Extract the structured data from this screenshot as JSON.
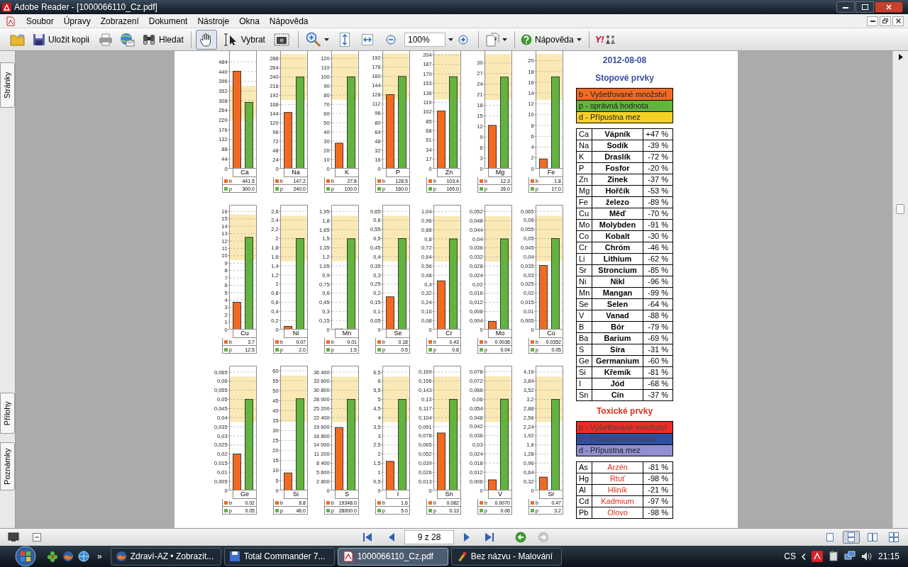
{
  "window": {
    "title": "Adobe Reader - [1000066110_Cz.pdf]"
  },
  "menu": [
    "Soubor",
    "Úpravy",
    "Zobrazení",
    "Dokument",
    "Nástroje",
    "Okna",
    "Nápověda"
  ],
  "toolbar": {
    "save": "Uložit kopii",
    "search": "Hledat",
    "tools": [
      {
        "kind": "hand",
        "selected": true
      },
      {
        "kind": "select",
        "label": "Vybrat",
        "selected": false
      }
    ],
    "zoom": "100%",
    "help": "Nápověda",
    "logo": "Y!"
  },
  "side_tabs": [
    "Stránky",
    "Přílohy",
    "Poznámky"
  ],
  "charts": [
    {
      "readings": [
        "441.5",
        "300.0"
      ],
      "chart_data": {
        "type": "bar",
        "grid": true,
        "legend": true,
        "bands": [
          {
            "axis": "y",
            "from": 225,
            "to": 375
          }
        ],
        "categories": [
          "Ca"
        ],
        "series": [
          {
            "name": "b",
            "color": "#f26a21",
            "values": [
              441.5
            ]
          },
          {
            "name": "p",
            "color": "#63b33f",
            "values": [
              300
            ]
          }
        ],
        "ylim": [
          0,
          533
        ],
        "yticks": [
          0,
          44,
          88,
          132,
          176,
          220,
          264,
          308,
          352,
          396,
          440,
          484
        ]
      }
    },
    {
      "readings": [
        "147.2",
        "240.0"
      ],
      "chart_data": {
        "type": "bar",
        "grid": true,
        "legend": true,
        "bands": [
          {
            "axis": "y",
            "from": 180,
            "to": 300
          }
        ],
        "categories": [
          "Na"
        ],
        "series": [
          {
            "name": "b",
            "color": "#f26a21",
            "values": [
              147.2
            ]
          },
          {
            "name": "p",
            "color": "#63b33f",
            "values": [
              240
            ]
          }
        ],
        "ylim": [
          0,
          308
        ],
        "yticks": [
          0,
          24,
          48,
          72,
          96,
          120,
          144,
          168,
          192,
          216,
          240,
          264,
          288
        ]
      }
    },
    {
      "readings": [
        "27.8",
        "100.0"
      ],
      "chart_data": {
        "type": "bar",
        "grid": true,
        "legend": true,
        "bands": [
          {
            "axis": "y",
            "from": 75,
            "to": 125
          }
        ],
        "categories": [
          "K"
        ],
        "series": [
          {
            "name": "b",
            "color": "#f26a21",
            "values": [
              27.8
            ]
          },
          {
            "name": "p",
            "color": "#63b33f",
            "values": [
              100
            ]
          }
        ],
        "ylim": [
          0,
          128
        ],
        "yticks": [
          0,
          10,
          20,
          30,
          40,
          50,
          60,
          70,
          80,
          90,
          100,
          110,
          120
        ]
      }
    },
    {
      "readings": [
        "128.5",
        "160.0"
      ],
      "chart_data": {
        "type": "bar",
        "grid": true,
        "legend": true,
        "bands": [
          {
            "axis": "y",
            "from": 120,
            "to": 200
          }
        ],
        "categories": [
          "P"
        ],
        "series": [
          {
            "name": "b",
            "color": "#f26a21",
            "values": [
              128.5
            ]
          },
          {
            "name": "p",
            "color": "#63b33f",
            "values": [
              160
            ]
          }
        ],
        "ylim": [
          0,
          204
        ],
        "yticks": [
          0,
          16,
          32,
          48,
          64,
          80,
          96,
          112,
          128,
          144,
          160,
          176,
          192
        ]
      }
    },
    {
      "readings": [
        "103.4",
        "165.0"
      ],
      "chart_data": {
        "type": "bar",
        "grid": true,
        "legend": true,
        "bands": [
          {
            "axis": "y",
            "from": 124,
            "to": 206
          }
        ],
        "categories": [
          "Zn"
        ],
        "series": [
          {
            "name": "b",
            "color": "#f26a21",
            "values": [
              103.4
            ]
          },
          {
            "name": "p",
            "color": "#63b33f",
            "values": [
              165
            ]
          }
        ],
        "ylim": [
          0,
          211
        ],
        "yticks": [
          0,
          17,
          34,
          51,
          68,
          85,
          102,
          119,
          136,
          153,
          170,
          187,
          204
        ]
      }
    },
    {
      "readings": [
        "12.3",
        "26.0"
      ],
      "chart_data": {
        "type": "bar",
        "grid": true,
        "legend": true,
        "bands": [
          {
            "axis": "y",
            "from": 19.5,
            "to": 32.5
          }
        ],
        "categories": [
          "Mg"
        ],
        "series": [
          {
            "name": "b",
            "color": "#f26a21",
            "values": [
              12.3
            ]
          },
          {
            "name": "p",
            "color": "#63b33f",
            "values": [
              26
            ]
          }
        ],
        "ylim": [
          0,
          33.4
        ],
        "yticks": [
          0,
          3,
          6,
          9,
          12,
          15,
          18,
          21,
          24,
          27,
          30
        ]
      }
    },
    {
      "readings": [
        "1.8",
        "17.0"
      ],
      "chart_data": {
        "type": "bar",
        "grid": true,
        "legend": true,
        "bands": [
          {
            "axis": "y",
            "from": 12.75,
            "to": 21.25
          }
        ],
        "categories": [
          "Fe"
        ],
        "series": [
          {
            "name": "b",
            "color": "#f26a21",
            "values": [
              1.8
            ]
          },
          {
            "name": "p",
            "color": "#63b33f",
            "values": [
              17
            ]
          }
        ],
        "ylim": [
          0,
          21.8
        ],
        "yticks": [
          0,
          2,
          4,
          6,
          8,
          10,
          12,
          14,
          16,
          18,
          20
        ]
      }
    },
    {
      "readings": [
        "3.7",
        "12.5"
      ],
      "chart_data": {
        "type": "bar",
        "grid": true,
        "legend": true,
        "bands": [
          {
            "axis": "y",
            "from": 9.4,
            "to": 15.6
          }
        ],
        "categories": [
          "Cu"
        ],
        "series": [
          {
            "name": "b",
            "color": "#f26a21",
            "values": [
              3.7
            ]
          },
          {
            "name": "p",
            "color": "#63b33f",
            "values": [
              12.5
            ]
          }
        ],
        "ylim": [
          0,
          16.9
        ],
        "yticks": [
          0,
          1,
          2,
          3,
          4,
          5,
          6,
          7,
          8,
          9,
          10,
          11,
          12,
          13,
          14,
          15,
          16
        ]
      }
    },
    {
      "readings": [
        "0.07",
        "2.0"
      ],
      "chart_data": {
        "type": "bar",
        "grid": true,
        "legend": true,
        "bands": [
          {
            "axis": "y",
            "from": 1.5,
            "to": 2.5
          }
        ],
        "categories": [
          "Ni"
        ],
        "series": [
          {
            "name": "b",
            "color": "#f26a21",
            "values": [
              0.07
            ]
          },
          {
            "name": "p",
            "color": "#63b33f",
            "values": [
              2
            ]
          }
        ],
        "ylim": [
          0,
          2.74
        ],
        "yticks": [
          0,
          {
            "value": 0.2,
            "label": "0,2"
          },
          {
            "value": 0.4,
            "label": "0,4"
          },
          {
            "value": 0.6,
            "label": "0,6"
          },
          {
            "value": 0.8,
            "label": "0,8"
          },
          1,
          {
            "value": 1.2,
            "label": "1,2"
          },
          {
            "value": 1.4,
            "label": "1,4"
          },
          {
            "value": 1.6,
            "label": "1,6"
          },
          {
            "value": 1.8,
            "label": "1,8"
          },
          2,
          {
            "value": 2.2,
            "label": "2,2"
          },
          {
            "value": 2.4,
            "label": "2,4"
          },
          {
            "value": 2.6,
            "label": "2,6"
          }
        ]
      }
    },
    {
      "readings": [
        "0.01",
        "1.5"
      ],
      "chart_data": {
        "type": "bar",
        "grid": true,
        "legend": true,
        "bands": [
          {
            "axis": "y",
            "from": 1.13,
            "to": 1.88
          }
        ],
        "categories": [
          "Mn"
        ],
        "series": [
          {
            "name": "b",
            "color": "#f26a21",
            "values": [
              0.01
            ]
          },
          {
            "name": "p",
            "color": "#63b33f",
            "values": [
              1.5
            ]
          }
        ],
        "ylim": [
          0,
          2.06
        ],
        "yticks": [
          0,
          {
            "value": 0.15,
            "label": "0,15"
          },
          {
            "value": 0.3,
            "label": "0,3"
          },
          {
            "value": 0.45,
            "label": "0,45"
          },
          {
            "value": 0.6,
            "label": "0,6"
          },
          {
            "value": 0.75,
            "label": "0,75"
          },
          {
            "value": 0.9,
            "label": "0,9"
          },
          {
            "value": 1.05,
            "label": "1,05"
          },
          {
            "value": 1.2,
            "label": "1,2"
          },
          {
            "value": 1.35,
            "label": "1,35"
          },
          {
            "value": 1.5,
            "label": "1,5"
          },
          {
            "value": 1.65,
            "label": "1,65"
          },
          {
            "value": 1.8,
            "label": "1,8"
          },
          {
            "value": 1.95,
            "label": "1,95"
          }
        ]
      }
    },
    {
      "readings": [
        "0.18",
        "0.5"
      ],
      "chart_data": {
        "type": "bar",
        "grid": true,
        "legend": true,
        "bands": [
          {
            "axis": "y",
            "from": 0.375,
            "to": 0.625
          }
        ],
        "categories": [
          "Se"
        ],
        "series": [
          {
            "name": "b",
            "color": "#f26a21",
            "values": [
              0.18
            ]
          },
          {
            "name": "p",
            "color": "#63b33f",
            "values": [
              0.5
            ]
          }
        ],
        "ylim": [
          0,
          0.685
        ],
        "yticks": [
          0,
          {
            "value": 0.05,
            "label": "0,05"
          },
          {
            "value": 0.1,
            "label": "0,1"
          },
          {
            "value": 0.15,
            "label": "0,15"
          },
          {
            "value": 0.2,
            "label": "0,2"
          },
          {
            "value": 0.25,
            "label": "0,25"
          },
          {
            "value": 0.3,
            "label": "0,3"
          },
          {
            "value": 0.35,
            "label": "0,35"
          },
          {
            "value": 0.4,
            "label": "0,4"
          },
          {
            "value": 0.45,
            "label": "0,45"
          },
          {
            "value": 0.5,
            "label": "0,5"
          },
          {
            "value": 0.55,
            "label": "0,55"
          },
          {
            "value": 0.6,
            "label": "0,6"
          },
          {
            "value": 0.65,
            "label": "0,65"
          }
        ]
      }
    },
    {
      "readings": [
        "0.43",
        "0.8"
      ],
      "chart_data": {
        "type": "bar",
        "grid": true,
        "legend": true,
        "bands": [
          {
            "axis": "y",
            "from": 0.6,
            "to": 1
          }
        ],
        "categories": [
          "Cr"
        ],
        "series": [
          {
            "name": "b",
            "color": "#f26a21",
            "values": [
              0.43
            ]
          },
          {
            "name": "p",
            "color": "#63b33f",
            "values": [
              0.8
            ]
          }
        ],
        "ylim": [
          0,
          1.1
        ],
        "yticks": [
          0,
          {
            "value": 0.08,
            "label": "0,08"
          },
          {
            "value": 0.16,
            "label": "0,16"
          },
          {
            "value": 0.24,
            "label": "0,24"
          },
          {
            "value": 0.32,
            "label": "0,32"
          },
          {
            "value": 0.4,
            "label": "0,4"
          },
          {
            "value": 0.48,
            "label": "0,48"
          },
          {
            "value": 0.56,
            "label": "0,56"
          },
          {
            "value": 0.64,
            "label": "0,64"
          },
          {
            "value": 0.72,
            "label": "0,72"
          },
          {
            "value": 0.8,
            "label": "0,8"
          },
          {
            "value": 0.88,
            "label": "0,88"
          },
          {
            "value": 0.96,
            "label": "0,96"
          },
          {
            "value": 1.04,
            "label": "1,04"
          }
        ]
      }
    },
    {
      "readings": [
        "0.0036",
        "0.04"
      ],
      "chart_data": {
        "type": "bar",
        "grid": true,
        "legend": true,
        "bands": [
          {
            "axis": "y",
            "from": 0.03,
            "to": 0.05
          }
        ],
        "categories": [
          "Mo"
        ],
        "series": [
          {
            "name": "b",
            "color": "#f26a21",
            "values": [
              0.0036
            ]
          },
          {
            "name": "p",
            "color": "#63b33f",
            "values": [
              0.04
            ]
          }
        ],
        "ylim": [
          0,
          0.055
        ],
        "yticks": [
          0,
          {
            "value": 0.004,
            "label": "0,004"
          },
          {
            "value": 0.008,
            "label": "0,008"
          },
          {
            "value": 0.012,
            "label": "0,012"
          },
          {
            "value": 0.016,
            "label": "0,016"
          },
          {
            "value": 0.02,
            "label": "0,02"
          },
          {
            "value": 0.024,
            "label": "0,024"
          },
          {
            "value": 0.028,
            "label": "0,028"
          },
          {
            "value": 0.032,
            "label": "0,032"
          },
          {
            "value": 0.036,
            "label": "0,036"
          },
          {
            "value": 0.04,
            "label": "0,04"
          },
          {
            "value": 0.044,
            "label": "0,044"
          },
          {
            "value": 0.048,
            "label": "0,048"
          },
          {
            "value": 0.052,
            "label": "0,052"
          }
        ]
      }
    },
    {
      "readings": [
        "0.0352",
        "0.05"
      ],
      "chart_data": {
        "type": "bar",
        "grid": true,
        "legend": true,
        "bands": [
          {
            "axis": "y",
            "from": 0.0375,
            "to": 0.0625
          }
        ],
        "categories": [
          "Co"
        ],
        "series": [
          {
            "name": "b",
            "color": "#f26a21",
            "values": [
              0.0352
            ]
          },
          {
            "name": "p",
            "color": "#63b33f",
            "values": [
              0.05
            ]
          }
        ],
        "ylim": [
          0,
          0.0685
        ],
        "yticks": [
          0,
          {
            "value": 0.005,
            "label": "0,005"
          },
          {
            "value": 0.01,
            "label": "0,01"
          },
          {
            "value": 0.015,
            "label": "0,015"
          },
          {
            "value": 0.02,
            "label": "0,02"
          },
          {
            "value": 0.025,
            "label": "0,025"
          },
          {
            "value": 0.03,
            "label": "0,03"
          },
          {
            "value": 0.035,
            "label": "0,035"
          },
          {
            "value": 0.04,
            "label": "0,04"
          },
          {
            "value": 0.045,
            "label": "0,045"
          },
          {
            "value": 0.05,
            "label": "0,05"
          },
          {
            "value": 0.055,
            "label": "0,055"
          },
          {
            "value": 0.06,
            "label": "0,06"
          },
          {
            "value": 0.065,
            "label": "0,065"
          }
        ]
      }
    },
    {
      "readings": [
        "0.02",
        "0.05"
      ],
      "chart_data": {
        "type": "bar",
        "grid": true,
        "legend": true,
        "bands": [
          {
            "axis": "y",
            "from": 0.0375,
            "to": 0.0625
          }
        ],
        "categories": [
          "Ge"
        ],
        "series": [
          {
            "name": "b",
            "color": "#f26a21",
            "values": [
              0.02
            ]
          },
          {
            "name": "p",
            "color": "#63b33f",
            "values": [
              0.05
            ]
          }
        ],
        "ylim": [
          0,
          0.0685
        ],
        "yticks": [
          0,
          {
            "value": 0.005,
            "label": "0,005"
          },
          {
            "value": 0.01,
            "label": "0,01"
          },
          {
            "value": 0.015,
            "label": "0,015"
          },
          {
            "value": 0.02,
            "label": "0,02"
          },
          {
            "value": 0.025,
            "label": "0,025"
          },
          {
            "value": 0.03,
            "label": "0,03"
          },
          {
            "value": 0.035,
            "label": "0,035"
          },
          {
            "value": 0.04,
            "label": "0,04"
          },
          {
            "value": 0.045,
            "label": "0,045"
          },
          {
            "value": 0.05,
            "label": "0,05"
          },
          {
            "value": 0.055,
            "label": "0,055"
          },
          {
            "value": 0.06,
            "label": "0,06"
          },
          {
            "value": 0.065,
            "label": "0,065"
          }
        ]
      }
    },
    {
      "readings": [
        "8.8",
        "46.0"
      ],
      "chart_data": {
        "type": "bar",
        "grid": true,
        "legend": true,
        "bands": [
          {
            "axis": "y",
            "from": 34.5,
            "to": 57.5
          }
        ],
        "categories": [
          "Si"
        ],
        "series": [
          {
            "name": "b",
            "color": "#f26a21",
            "values": [
              8.8
            ]
          },
          {
            "name": "p",
            "color": "#63b33f",
            "values": [
              46
            ]
          }
        ],
        "ylim": [
          0,
          62.5
        ],
        "yticks": [
          0,
          5,
          10,
          15,
          20,
          25,
          30,
          35,
          40,
          45,
          50,
          55,
          60
        ]
      }
    },
    {
      "readings": [
        "19348.0",
        "28000.0"
      ],
      "chart_data": {
        "type": "bar",
        "grid": true,
        "legend": true,
        "bands": [
          {
            "axis": "y",
            "from": 21000,
            "to": 35000
          }
        ],
        "categories": [
          "S"
        ],
        "series": [
          {
            "name": "b",
            "color": "#f26a21",
            "values": [
              19348
            ]
          },
          {
            "name": "p",
            "color": "#63b33f",
            "values": [
              28000
            ]
          }
        ],
        "ylim": [
          0,
          38360
        ],
        "yticks": [
          0,
          {
            "value": 2800,
            "label": "2 800"
          },
          {
            "value": 5600,
            "label": "5 600"
          },
          {
            "value": 8400,
            "label": "8 400"
          },
          {
            "value": 11200,
            "label": "11 200"
          },
          {
            "value": 14000,
            "label": "14 000"
          },
          {
            "value": 16800,
            "label": "16 800"
          },
          {
            "value": 19600,
            "label": "19 600"
          },
          {
            "value": 22400,
            "label": "22 400"
          },
          {
            "value": 25200,
            "label": "25 200"
          },
          {
            "value": 28000,
            "label": "28 000"
          },
          {
            "value": 30800,
            "label": "30 800"
          },
          {
            "value": 33600,
            "label": "33 600"
          },
          {
            "value": 36400,
            "label": "36 400"
          }
        ]
      }
    },
    {
      "readings": [
        "1.6",
        "5.0"
      ],
      "chart_data": {
        "type": "bar",
        "grid": true,
        "legend": true,
        "bands": [
          {
            "axis": "y",
            "from": 3.75,
            "to": 6.25
          }
        ],
        "categories": [
          "I"
        ],
        "series": [
          {
            "name": "b",
            "color": "#f26a21",
            "values": [
              1.6
            ]
          },
          {
            "name": "p",
            "color": "#63b33f",
            "values": [
              5
            ]
          }
        ],
        "ylim": [
          0,
          6.85
        ],
        "yticks": [
          0,
          {
            "value": 0.5,
            "label": "0,5"
          },
          1,
          {
            "value": 1.5,
            "label": "1,5"
          },
          2,
          {
            "value": 2.5,
            "label": "2,5"
          },
          3,
          {
            "value": 3.5,
            "label": "3,5"
          },
          4,
          {
            "value": 4.5,
            "label": "4,5"
          },
          5,
          {
            "value": 5.5,
            "label": "5,5"
          },
          6,
          {
            "value": 6.5,
            "label": "6,5"
          }
        ]
      }
    },
    {
      "readings": [
        "0.082",
        "0.13"
      ],
      "chart_data": {
        "type": "bar",
        "grid": true,
        "legend": true,
        "bands": [
          {
            "axis": "y",
            "from": 0.0975,
            "to": 0.1625
          }
        ],
        "categories": [
          "Sn"
        ],
        "series": [
          {
            "name": "b",
            "color": "#f26a21",
            "values": [
              0.082
            ]
          },
          {
            "name": "p",
            "color": "#63b33f",
            "values": [
              0.13
            ]
          }
        ],
        "ylim": [
          0,
          0.178
        ],
        "yticks": [
          0,
          {
            "value": 0.013,
            "label": "0,013"
          },
          {
            "value": 0.026,
            "label": "0,026"
          },
          {
            "value": 0.039,
            "label": "0,039"
          },
          {
            "value": 0.052,
            "label": "0,052"
          },
          {
            "value": 0.065,
            "label": "0,065"
          },
          {
            "value": 0.078,
            "label": "0,078"
          },
          {
            "value": 0.091,
            "label": "0,091"
          },
          {
            "value": 0.104,
            "label": "0,104"
          },
          {
            "value": 0.117,
            "label": "0,117"
          },
          {
            "value": 0.13,
            "label": "0,13"
          },
          {
            "value": 0.143,
            "label": "0,143"
          },
          {
            "value": 0.156,
            "label": "0,156"
          },
          {
            "value": 0.169,
            "label": "0,169"
          }
        ]
      }
    },
    {
      "readings": [
        "0.0070",
        "0.06"
      ],
      "chart_data": {
        "type": "bar",
        "grid": true,
        "legend": true,
        "bands": [
          {
            "axis": "y",
            "from": 0.045,
            "to": 0.075
          }
        ],
        "categories": [
          "V"
        ],
        "series": [
          {
            "name": "b",
            "color": "#f26a21",
            "values": [
              0.007
            ]
          },
          {
            "name": "p",
            "color": "#63b33f",
            "values": [
              0.06
            ]
          }
        ],
        "ylim": [
          0,
          0.082
        ],
        "yticks": [
          0,
          {
            "value": 0.006,
            "label": "0,006"
          },
          {
            "value": 0.012,
            "label": "0,012"
          },
          {
            "value": 0.018,
            "label": "0,018"
          },
          {
            "value": 0.024,
            "label": "0,024"
          },
          {
            "value": 0.03,
            "label": "0,03"
          },
          {
            "value": 0.036,
            "label": "0,036"
          },
          {
            "value": 0.042,
            "label": "0,042"
          },
          {
            "value": 0.048,
            "label": "0,048"
          },
          {
            "value": 0.054,
            "label": "0,054"
          },
          {
            "value": 0.06,
            "label": "0,06"
          },
          {
            "value": 0.066,
            "label": "0,066"
          },
          {
            "value": 0.072,
            "label": "0,072"
          },
          {
            "value": 0.078,
            "label": "0,078"
          }
        ]
      }
    },
    {
      "readings": [
        "0.47",
        "3.2"
      ],
      "chart_data": {
        "type": "bar",
        "grid": true,
        "legend": true,
        "bands": [
          {
            "axis": "y",
            "from": 2.4,
            "to": 4
          }
        ],
        "categories": [
          "Sr"
        ],
        "series": [
          {
            "name": "b",
            "color": "#f26a21",
            "values": [
              0.47
            ]
          },
          {
            "name": "p",
            "color": "#63b33f",
            "values": [
              3.2
            ]
          }
        ],
        "ylim": [
          0,
          4.38
        ],
        "yticks": [
          0,
          {
            "value": 0.32,
            "label": "0,32"
          },
          {
            "value": 0.64,
            "label": "0,64"
          },
          {
            "value": 0.96,
            "label": "0,96"
          },
          {
            "value": 1.28,
            "label": "1,28"
          },
          {
            "value": 1.6,
            "label": "1,6"
          },
          {
            "value": 1.92,
            "label": "1,92"
          },
          {
            "value": 2.24,
            "label": "2,24"
          },
          {
            "value": 2.56,
            "label": "2,56"
          },
          {
            "value": 2.88,
            "label": "2,88"
          },
          {
            "value": 3.2,
            "label": "3,2"
          },
          {
            "value": 3.52,
            "label": "3,52"
          },
          {
            "value": 3.84,
            "label": "3,84"
          },
          {
            "value": 4.16,
            "label": "4,16"
          }
        ]
      }
    }
  ],
  "report": {
    "date": "2012-08-08",
    "sections": [
      {
        "kind": "trace",
        "title": "Stopové prvky",
        "legend": [
          {
            "text": "b - Vyšetřované množství",
            "color": "#f26a21"
          },
          {
            "text": "p - správná hodnota",
            "color": "#63b33f"
          },
          {
            "text": "d - Přípustna mez",
            "color": "#f5d027"
          }
        ],
        "rows": [
          {
            "symbol": "Ca",
            "name": "Vápník",
            "diff": "+47 %"
          },
          {
            "symbol": "Na",
            "name": "Sodík",
            "diff": "-39 %"
          },
          {
            "symbol": "K",
            "name": "Draslík",
            "diff": "-72 %"
          },
          {
            "symbol": "P",
            "name": "Fosfor",
            "diff": "-20 %"
          },
          {
            "symbol": "Zn",
            "name": "Zinek",
            "diff": "-37 %"
          },
          {
            "symbol": "Mg",
            "name": "Hořčík",
            "diff": "-53 %"
          },
          {
            "symbol": "Fe",
            "name": "železo",
            "diff": "-89 %"
          },
          {
            "symbol": "Cu",
            "name": "Měď",
            "diff": "-70 %"
          },
          {
            "symbol": "Mo",
            "name": "Molybden",
            "diff": "-91 %"
          },
          {
            "symbol": "Co",
            "name": "Kobalt",
            "diff": "-30 %"
          },
          {
            "symbol": "Cr",
            "name": "Chróm",
            "diff": "-46 %"
          },
          {
            "symbol": "Li",
            "name": "Lithium",
            "diff": "-62 %"
          },
          {
            "symbol": "Sr",
            "name": "Stroncium",
            "diff": "-85 %"
          },
          {
            "symbol": "Ni",
            "name": "Nikl",
            "diff": "-96 %"
          },
          {
            "symbol": "Mn",
            "name": "Mangan",
            "diff": "-99 %"
          },
          {
            "symbol": "Se",
            "name": "Selen",
            "diff": "-64 %"
          },
          {
            "symbol": "V",
            "name": "Vanad",
            "diff": "-88 %"
          },
          {
            "symbol": "B",
            "name": "Bór",
            "diff": "-79 %"
          },
          {
            "symbol": "Ba",
            "name": "Barium",
            "diff": "-69 %"
          },
          {
            "symbol": "S",
            "name": "Síra",
            "diff": "-31 %"
          },
          {
            "symbol": "Ge",
            "name": "Germanium",
            "diff": "-60 %"
          },
          {
            "symbol": "Si",
            "name": "Křemík",
            "diff": "-81 %"
          },
          {
            "symbol": "I",
            "name": "Jód",
            "diff": "-68 %"
          },
          {
            "symbol": "Sn",
            "name": "Cín",
            "diff": "-37 %"
          }
        ]
      },
      {
        "kind": "toxic",
        "title": "Toxické prvky",
        "legend": [
          {
            "text": "b - Vyšetřované množství",
            "color": "#ee2b24"
          },
          {
            "text": "p - Přípustná hodnota",
            "color": "#2f4ea1"
          },
          {
            "text": "d - Přípustna mez",
            "color": "#9090d0"
          }
        ],
        "rows": [
          {
            "symbol": "As",
            "name": "Arzén",
            "diff": "-81 %"
          },
          {
            "symbol": "Hg",
            "name": "Rtuť",
            "diff": "-98 %"
          },
          {
            "symbol": "Al",
            "name": "Hliník",
            "diff": "-21 %"
          },
          {
            "symbol": "Cd",
            "name": "Kadmium",
            "diff": "-97 %"
          },
          {
            "symbol": "Pb",
            "name": "Olovo",
            "diff": "-98 %"
          }
        ]
      }
    ]
  },
  "page_nav": {
    "page": "9 z 28"
  },
  "page_layouts": [
    {
      "kind": "single",
      "selected": false
    },
    {
      "kind": "continuous",
      "selected": true
    },
    {
      "kind": "facing",
      "selected": false
    },
    {
      "kind": "facing_continuous",
      "selected": false
    }
  ],
  "taskbar": {
    "items": [
      {
        "kind": "browser",
        "label": "Zdraví-AZ • Zobrazit...",
        "selected": false
      },
      {
        "kind": "commander",
        "label": "Total Commander 7...",
        "selected": false
      },
      {
        "kind": "pdf",
        "label": "1000066110_Cz.pdf",
        "selected": true
      },
      {
        "kind": "paint",
        "label": "Bez názvu - Malování",
        "selected": false
      }
    ],
    "overflow": "»",
    "lang": "CS",
    "time": "21:15"
  }
}
